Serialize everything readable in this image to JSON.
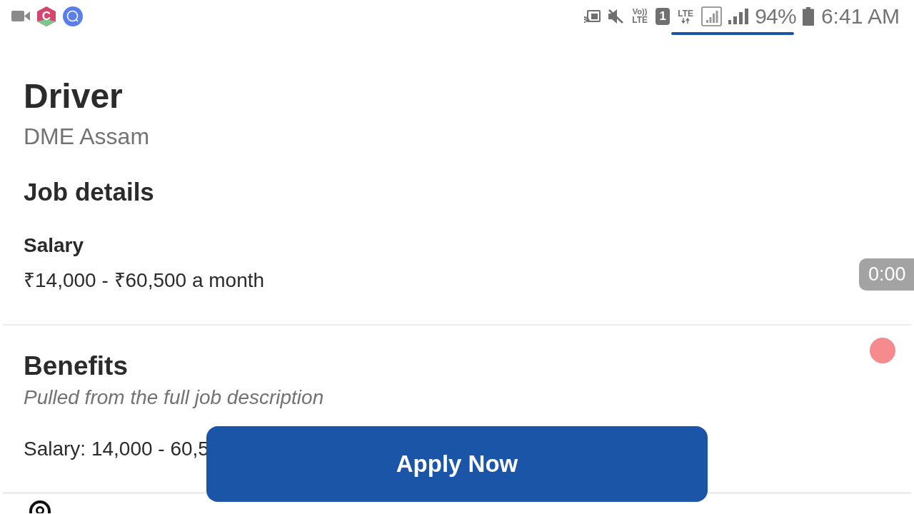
{
  "status_bar": {
    "app_icon_letter": "C",
    "volte": {
      "top": "Vo))",
      "bottom": "LTE"
    },
    "sim": "1",
    "data_type": "LTE",
    "battery": "94%",
    "time": "6:41 AM"
  },
  "job": {
    "title": "Driver",
    "company": "DME Assam"
  },
  "job_details": {
    "heading": "Job details",
    "salary": {
      "label": "Salary",
      "value": "₹14,000 - ₹60,500 a month"
    }
  },
  "benefits": {
    "heading": "Benefits",
    "note": "Pulled from the full job description",
    "items": [
      "Salary: 14,000 - 60,5"
    ]
  },
  "apply_button": "Apply Now",
  "recorder": {
    "timer": "0:00"
  }
}
